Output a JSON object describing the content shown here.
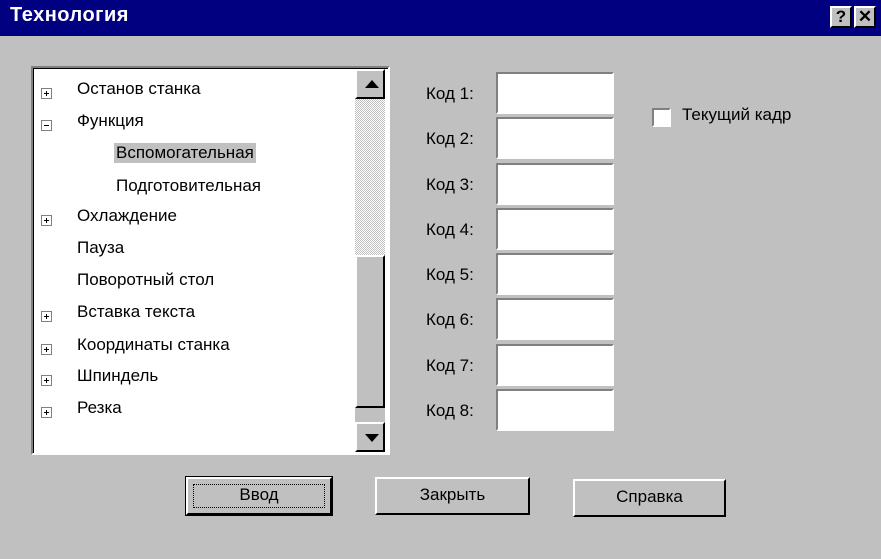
{
  "window": {
    "title": "Технология",
    "help_glyph": "?",
    "close_glyph": "✕"
  },
  "tree": {
    "items": [
      {
        "label": "Останов станка",
        "expander": "plus"
      },
      {
        "label": "Функция",
        "expander": "minus"
      },
      {
        "label": "Вспомогательная",
        "expander": "none",
        "selected": true
      },
      {
        "label": "Подготовительная",
        "expander": "none"
      },
      {
        "label": "Охлаждение",
        "expander": "plus"
      },
      {
        "label": "Пауза",
        "expander": "none"
      },
      {
        "label": "Поворотный стол",
        "expander": "none"
      },
      {
        "label": "Вставка текста",
        "expander": "plus"
      },
      {
        "label": "Координаты станка",
        "expander": "plus"
      },
      {
        "label": "Шпиндель",
        "expander": "plus"
      },
      {
        "label": "Резка",
        "expander": "plus"
      }
    ]
  },
  "codes": {
    "labels": [
      "Код 1:",
      "Код 2:",
      "Код 3:",
      "Код 4:",
      "Код 5:",
      "Код 6:",
      "Код 7:",
      "Код 8:"
    ],
    "values": [
      "",
      "",
      "",
      "",
      "",
      "",
      "",
      ""
    ]
  },
  "current_frame": {
    "label": "Текущий кадр",
    "checked": false
  },
  "buttons": {
    "enter": "Ввод",
    "close": "Закрыть",
    "help": "Справка"
  },
  "colors": {
    "titlebar": "#000080",
    "face": "#c0c0c0"
  }
}
